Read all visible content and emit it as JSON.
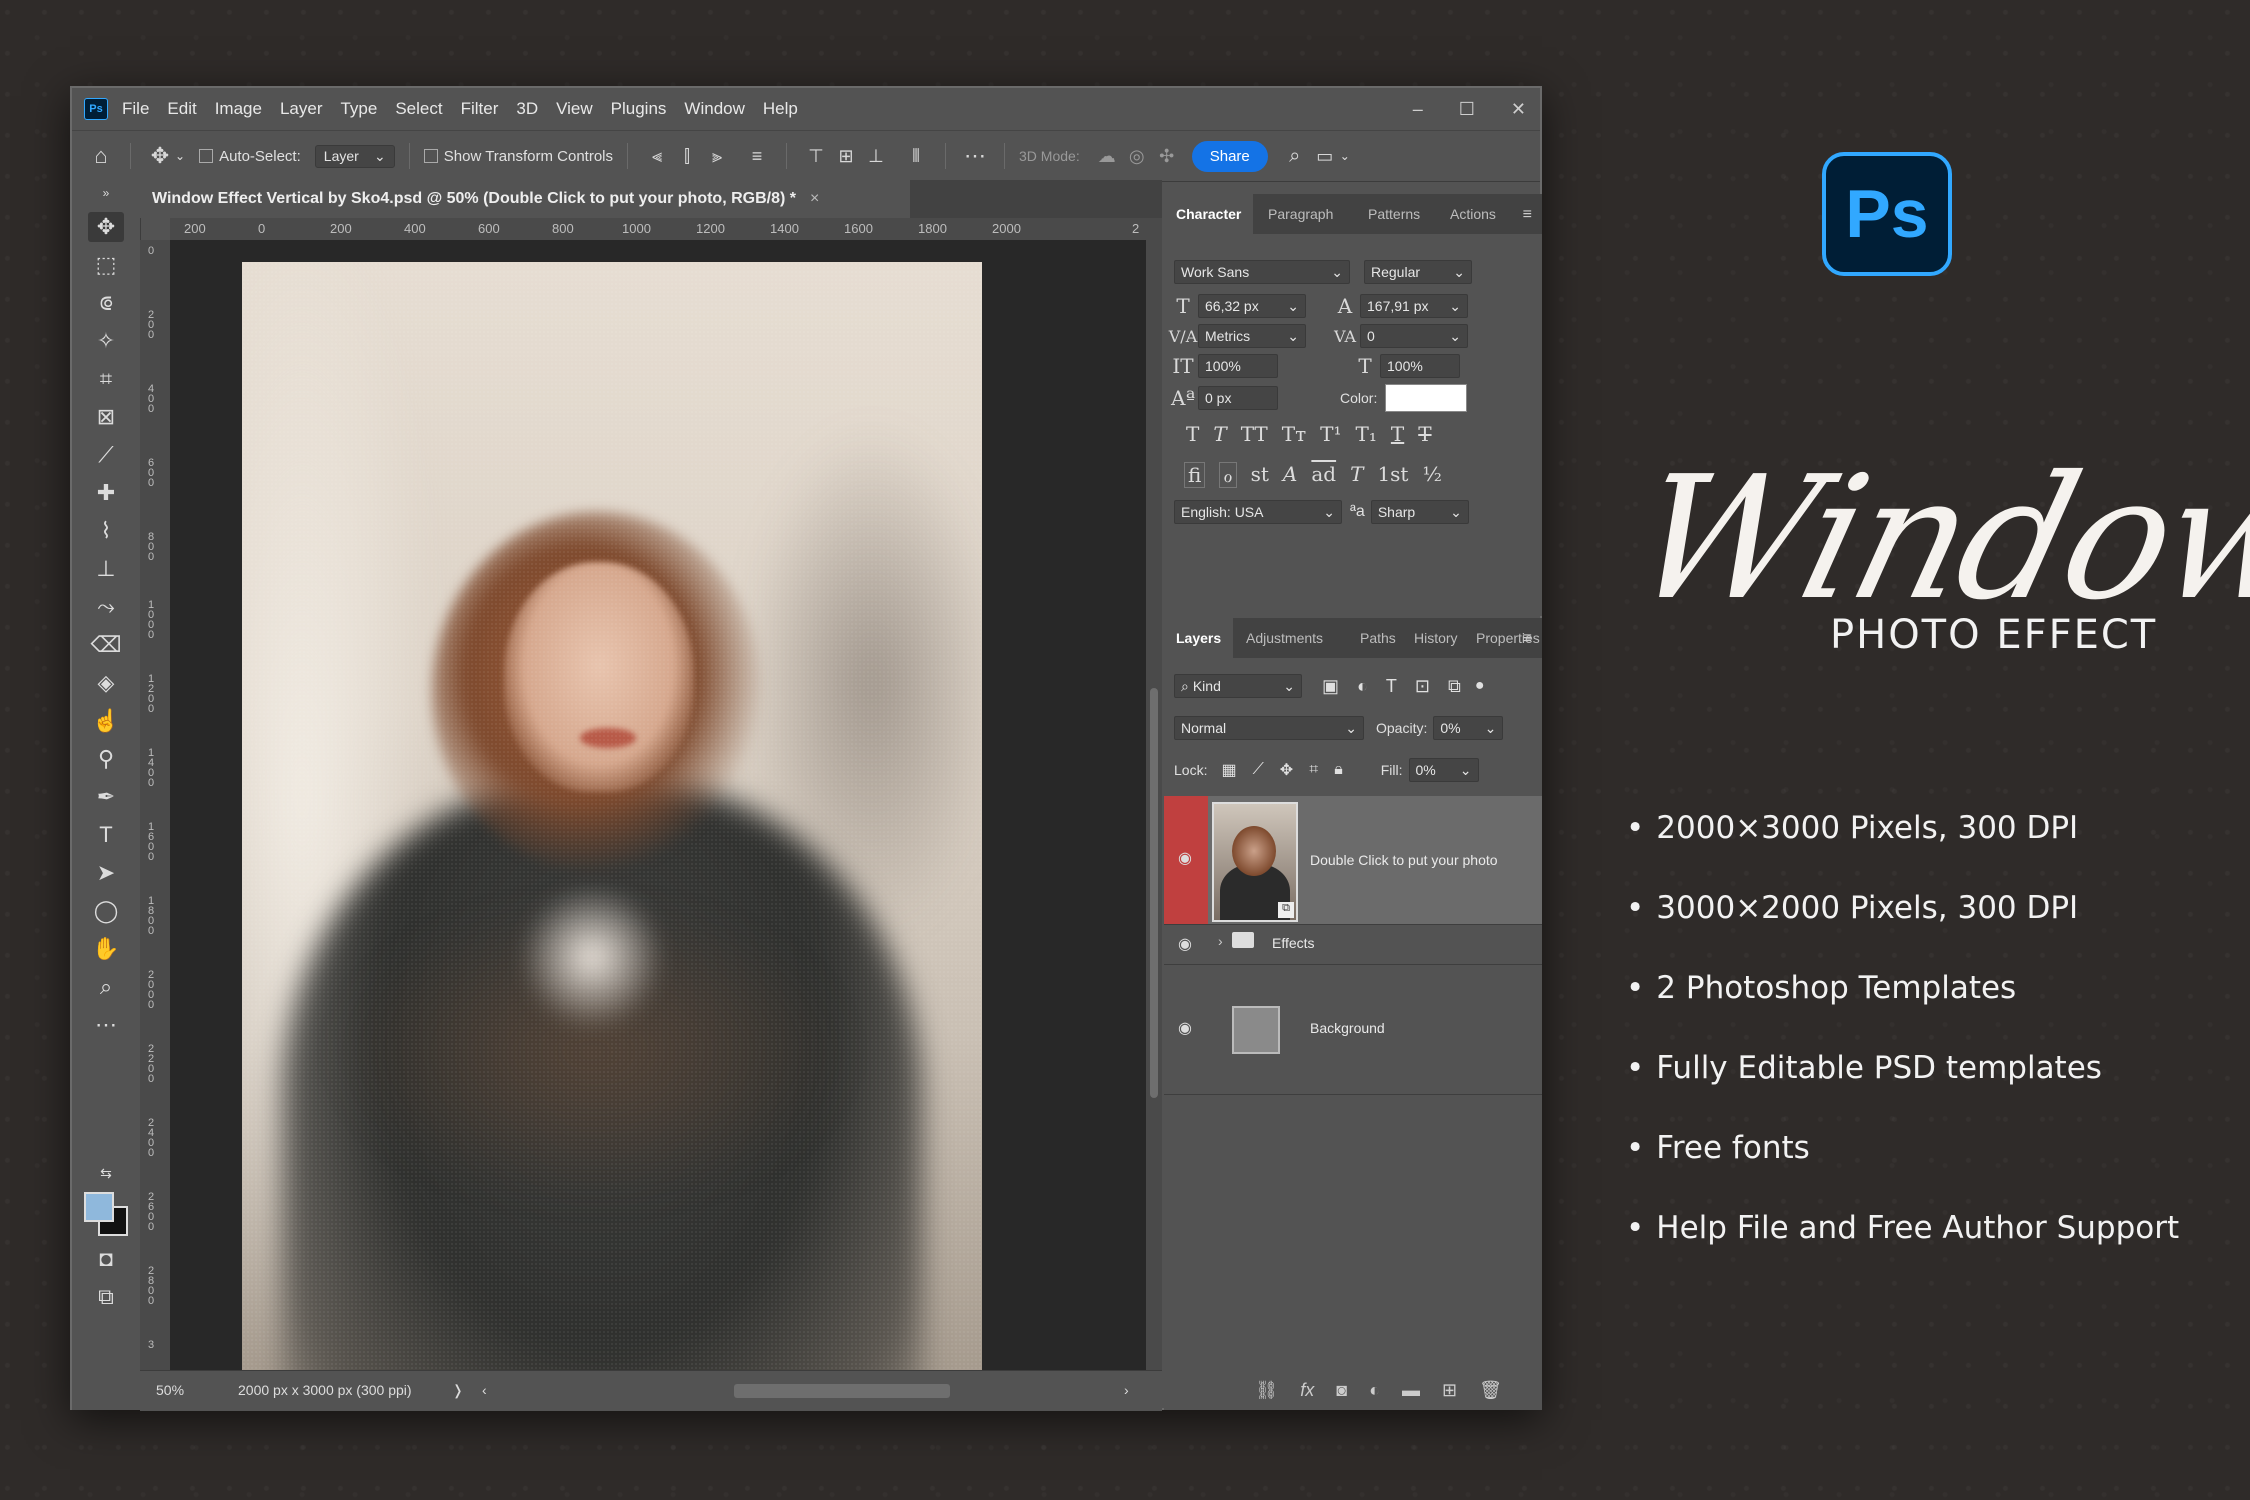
{
  "menu": {
    "app_logo": "Ps",
    "items": [
      "File",
      "Edit",
      "Image",
      "Layer",
      "Type",
      "Select",
      "Filter",
      "3D",
      "View",
      "Plugins",
      "Window",
      "Help"
    ],
    "window_controls": [
      "–",
      "☐",
      "✕"
    ]
  },
  "options_bar": {
    "auto_select_label": "Auto-Select:",
    "auto_select_target": "Layer",
    "show_transform_label": "Show Transform Controls",
    "mode_3d_label": "3D Mode:",
    "share_label": "Share"
  },
  "document": {
    "tab_title": "Window Effect Vertical by Sko4.psd @ 50% (Double Click to put your photo, RGB/8) *",
    "tab_close": "×",
    "ruler_top": [
      "200",
      "0",
      "200",
      "400",
      "600",
      "800",
      "1000",
      "1200",
      "1400",
      "1600",
      "1800",
      "2000",
      "2"
    ],
    "ruler_left": [
      "0",
      "200",
      "400",
      "600",
      "800",
      "1000",
      "1200",
      "1400",
      "1600",
      "1800",
      "2000",
      "2200",
      "2400",
      "2600",
      "2800",
      "3"
    ],
    "zoom": "50%",
    "doc_info": "2000 px x 3000 px (300 ppi)",
    "status_arrow": "❭"
  },
  "character_panel": {
    "tabs": [
      "Character",
      "Paragraph",
      "Patterns",
      "Actions"
    ],
    "font_family": "Work Sans",
    "font_style": "Regular",
    "font_size": "66,32 px",
    "leading": "167,91 px",
    "kerning": "Metrics",
    "tracking": "0",
    "vertical_scale": "100%",
    "horizontal_scale": "100%",
    "baseline_shift": "0 px",
    "color_label": "Color:",
    "color_value": "#ffffff",
    "language": "English: USA",
    "anti_alias_label": "ªa",
    "anti_alias": "Sharp",
    "style_glyphs": [
      "T",
      "T",
      "TT",
      "Tт",
      "T¹",
      "T₁",
      "T",
      "T"
    ],
    "opentype_glyphs": [
      "fi",
      "ℴ",
      "st",
      "A",
      "ad",
      "T",
      "1st",
      "½"
    ]
  },
  "layers_panel": {
    "tabs": [
      "Layers",
      "Adjustments",
      "Paths",
      "History",
      "Properties"
    ],
    "filter_kind": "Kind",
    "blend_mode": "Normal",
    "opacity_label": "Opacity:",
    "opacity_value": "0%",
    "lock_label": "Lock:",
    "fill_label": "Fill:",
    "fill_value": "0%",
    "layers": [
      {
        "name": "Double Click to put your photo",
        "type": "smart-object",
        "selected": true
      },
      {
        "name": "Effects",
        "type": "group"
      },
      {
        "name": "Background",
        "type": "layer"
      }
    ]
  },
  "promo": {
    "logo_text": "Ps",
    "title": "Window",
    "subtitle": "PHOTO EFFECT",
    "features": [
      "2000×3000 Pixels, 300 DPI",
      "3000×2000 Pixels, 300 DPI",
      "2 Photoshop Templates",
      "Fully Editable PSD templates",
      "Free fonts",
      "Help File and Free Author Support"
    ]
  },
  "colors": {
    "ps_blue": "#31a8ff",
    "ps_dark": "#001e36",
    "share_blue": "#1473e6",
    "selected_layer_marker": "#c0403f",
    "background": "#2f2b29"
  }
}
